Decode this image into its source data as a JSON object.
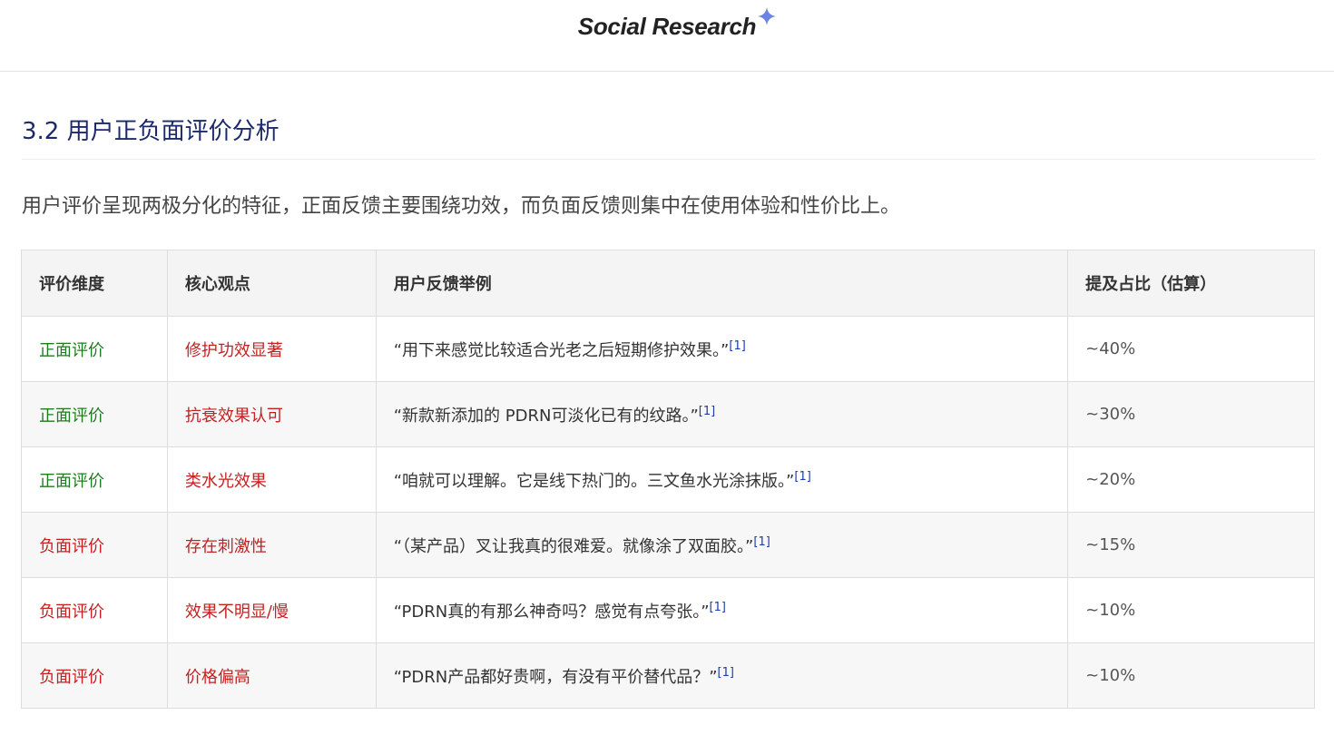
{
  "header": {
    "brand": "Social Research",
    "brand_icon": "sparkle-icon",
    "accent": "#6a84e6"
  },
  "section": {
    "title": "3.2 用户正负面评价分析",
    "intro": "用户评价呈现两极分化的特征，正面反馈主要围绕功效，而负面反馈则集中在使用体验和性价比上。"
  },
  "table": {
    "headers": [
      "评价维度",
      "核心观点",
      "用户反馈举例",
      "提及占比（估算）"
    ],
    "rows": [
      {
        "dimension": "正面评价",
        "polarity": "positive",
        "point": "修护功效显著",
        "quote": "“用下来感觉比较适合光老之后短期修护效果。”",
        "cite": "[1]",
        "share": "~40%"
      },
      {
        "dimension": "正面评价",
        "polarity": "positive",
        "point": "抗衰效果认可",
        "quote": "“新款新添加的 PDRN可淡化已有的纹路。”",
        "cite": "[1]",
        "share": "~30%"
      },
      {
        "dimension": "正面评价",
        "polarity": "positive",
        "point": "类水光效果",
        "quote": "“咱就可以理解。它是线下热门的。三文鱼水光涂抹版。”",
        "cite": "[1]",
        "share": "~20%"
      },
      {
        "dimension": "负面评价",
        "polarity": "negative",
        "point": "存在刺激性",
        "quote": "“（某产品）叉让我真的很难爱。就像涂了双面胶。”",
        "cite": "[1]",
        "share": "~15%"
      },
      {
        "dimension": "负面评价",
        "polarity": "negative",
        "point": "效果不明显/慢",
        "quote": "“PDRN真的有那么神奇吗？感觉有点夸张。”",
        "cite": "[1]",
        "share": "~10%"
      },
      {
        "dimension": "负面评价",
        "polarity": "negative",
        "point": "价格偏高",
        "quote": "“PDRN产品都好贵啊，有没有平价替代品？”",
        "cite": "[1]",
        "share": "~10%"
      }
    ]
  },
  "colors": {
    "positive": "#1e7b1e",
    "negative": "#c62020",
    "title": "#1c2a6b",
    "citation": "#1a3fa8"
  }
}
